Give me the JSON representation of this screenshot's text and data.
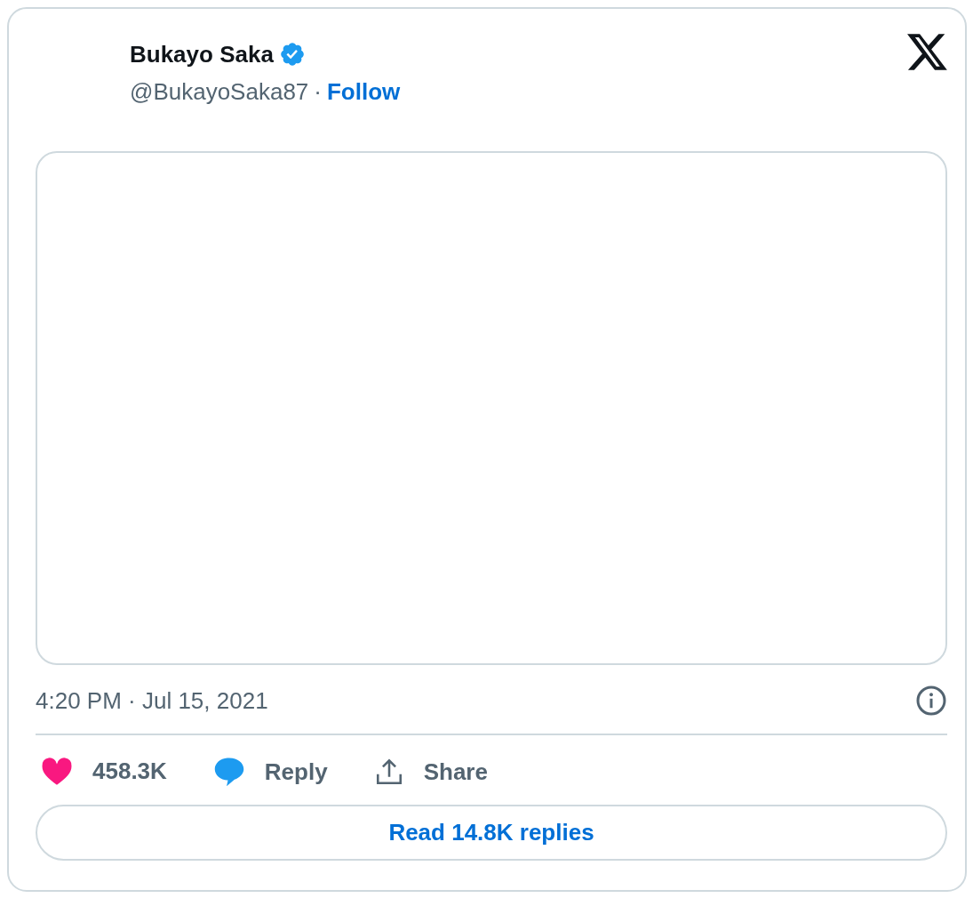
{
  "author": {
    "name": "Bukayo Saka",
    "verified": true,
    "handle": "@BukayoSaka87",
    "separator": "·",
    "follow": "Follow"
  },
  "timestamp": "4:20 PM · Jul 15, 2021",
  "actions": [
    {
      "kind": "like",
      "label": "458.3K",
      "liked": true
    },
    {
      "kind": "reply",
      "label": "Reply"
    },
    {
      "kind": "share",
      "label": "Share"
    }
  ],
  "read_replies": "Read 14.8K replies"
}
